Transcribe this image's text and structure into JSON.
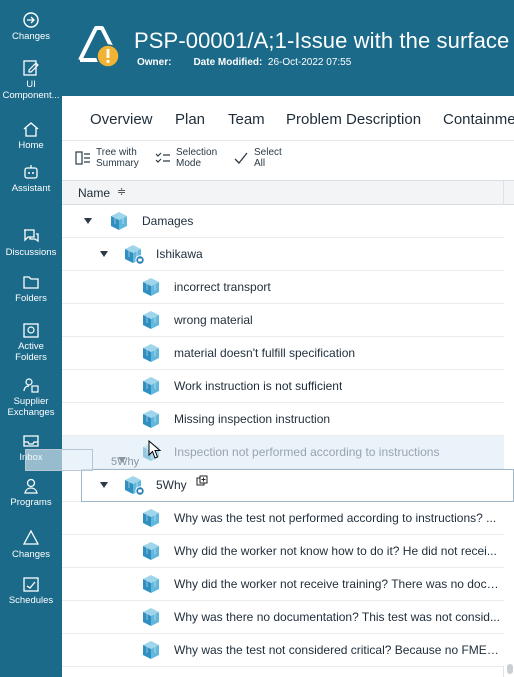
{
  "nav": {
    "items": [
      {
        "label": "Changes",
        "icon": "changes-icon"
      },
      {
        "label": "UI\nComponent...",
        "icon": "ui-component-icon"
      },
      {
        "label": "Home",
        "icon": "home-icon"
      },
      {
        "label": "Assistant",
        "icon": "assistant-icon"
      },
      {
        "label": "Discussions",
        "icon": "discussions-icon"
      },
      {
        "label": "Folders",
        "icon": "folder-icon"
      },
      {
        "label": "Active\nFolders",
        "icon": "active-folders-icon"
      },
      {
        "label": "Supplier\nExchanges",
        "icon": "supplier-exchanges-icon"
      },
      {
        "label": "Inbox",
        "icon": "inbox-icon"
      },
      {
        "label": "Programs",
        "icon": "programs-icon"
      },
      {
        "label": "Changes",
        "icon": "change-triangle-icon"
      },
      {
        "label": "Schedules",
        "icon": "schedules-icon"
      }
    ]
  },
  "header": {
    "title": "PSP-00001/A;1-Issue with the surface",
    "owner_label": "Owner:",
    "date_label": "Date Modified:",
    "date_value": "26-Oct-2022 07:55"
  },
  "tabs": [
    "Overview",
    "Plan",
    "Team",
    "Problem Description",
    "Containme"
  ],
  "toolbar": {
    "tree_summary": "Tree with\nSummary",
    "selection_mode": "Selection\nMode",
    "select_all": "Select\nAll"
  },
  "table": {
    "name_header": "Name",
    "sort_symbol": "≑"
  },
  "tree": [
    {
      "label": "Damages",
      "level": 0,
      "expandable": true
    },
    {
      "label": "Ishikawa",
      "level": 1,
      "expandable": true
    },
    {
      "label": "incorrect transport",
      "level": 2
    },
    {
      "label": "wrong material",
      "level": 2
    },
    {
      "label": "material doesn't fulfill specification",
      "level": 2
    },
    {
      "label": "Work instruction is not sufficient",
      "level": 2
    },
    {
      "label": "Missing inspection instruction",
      "level": 2
    },
    {
      "label": "Inspection not performed according to instructions",
      "level": 2,
      "ghost": true
    },
    {
      "label": "5Why",
      "level": 1,
      "expandable": true
    },
    {
      "label": "Why was the test not performed according to instructions? ...",
      "level": 2
    },
    {
      "label": "Why did the worker not know how to do it? He did not recei...",
      "level": 2
    },
    {
      "label": "Why did the worker not receive training? There was no docu...",
      "level": 2
    },
    {
      "label": "Why was there no documentation? This test was not consid...",
      "level": 2
    },
    {
      "label": "Why was the test not considered critical? Because no FMEA ...",
      "level": 2
    }
  ],
  "drag": {
    "label": "5Why"
  }
}
